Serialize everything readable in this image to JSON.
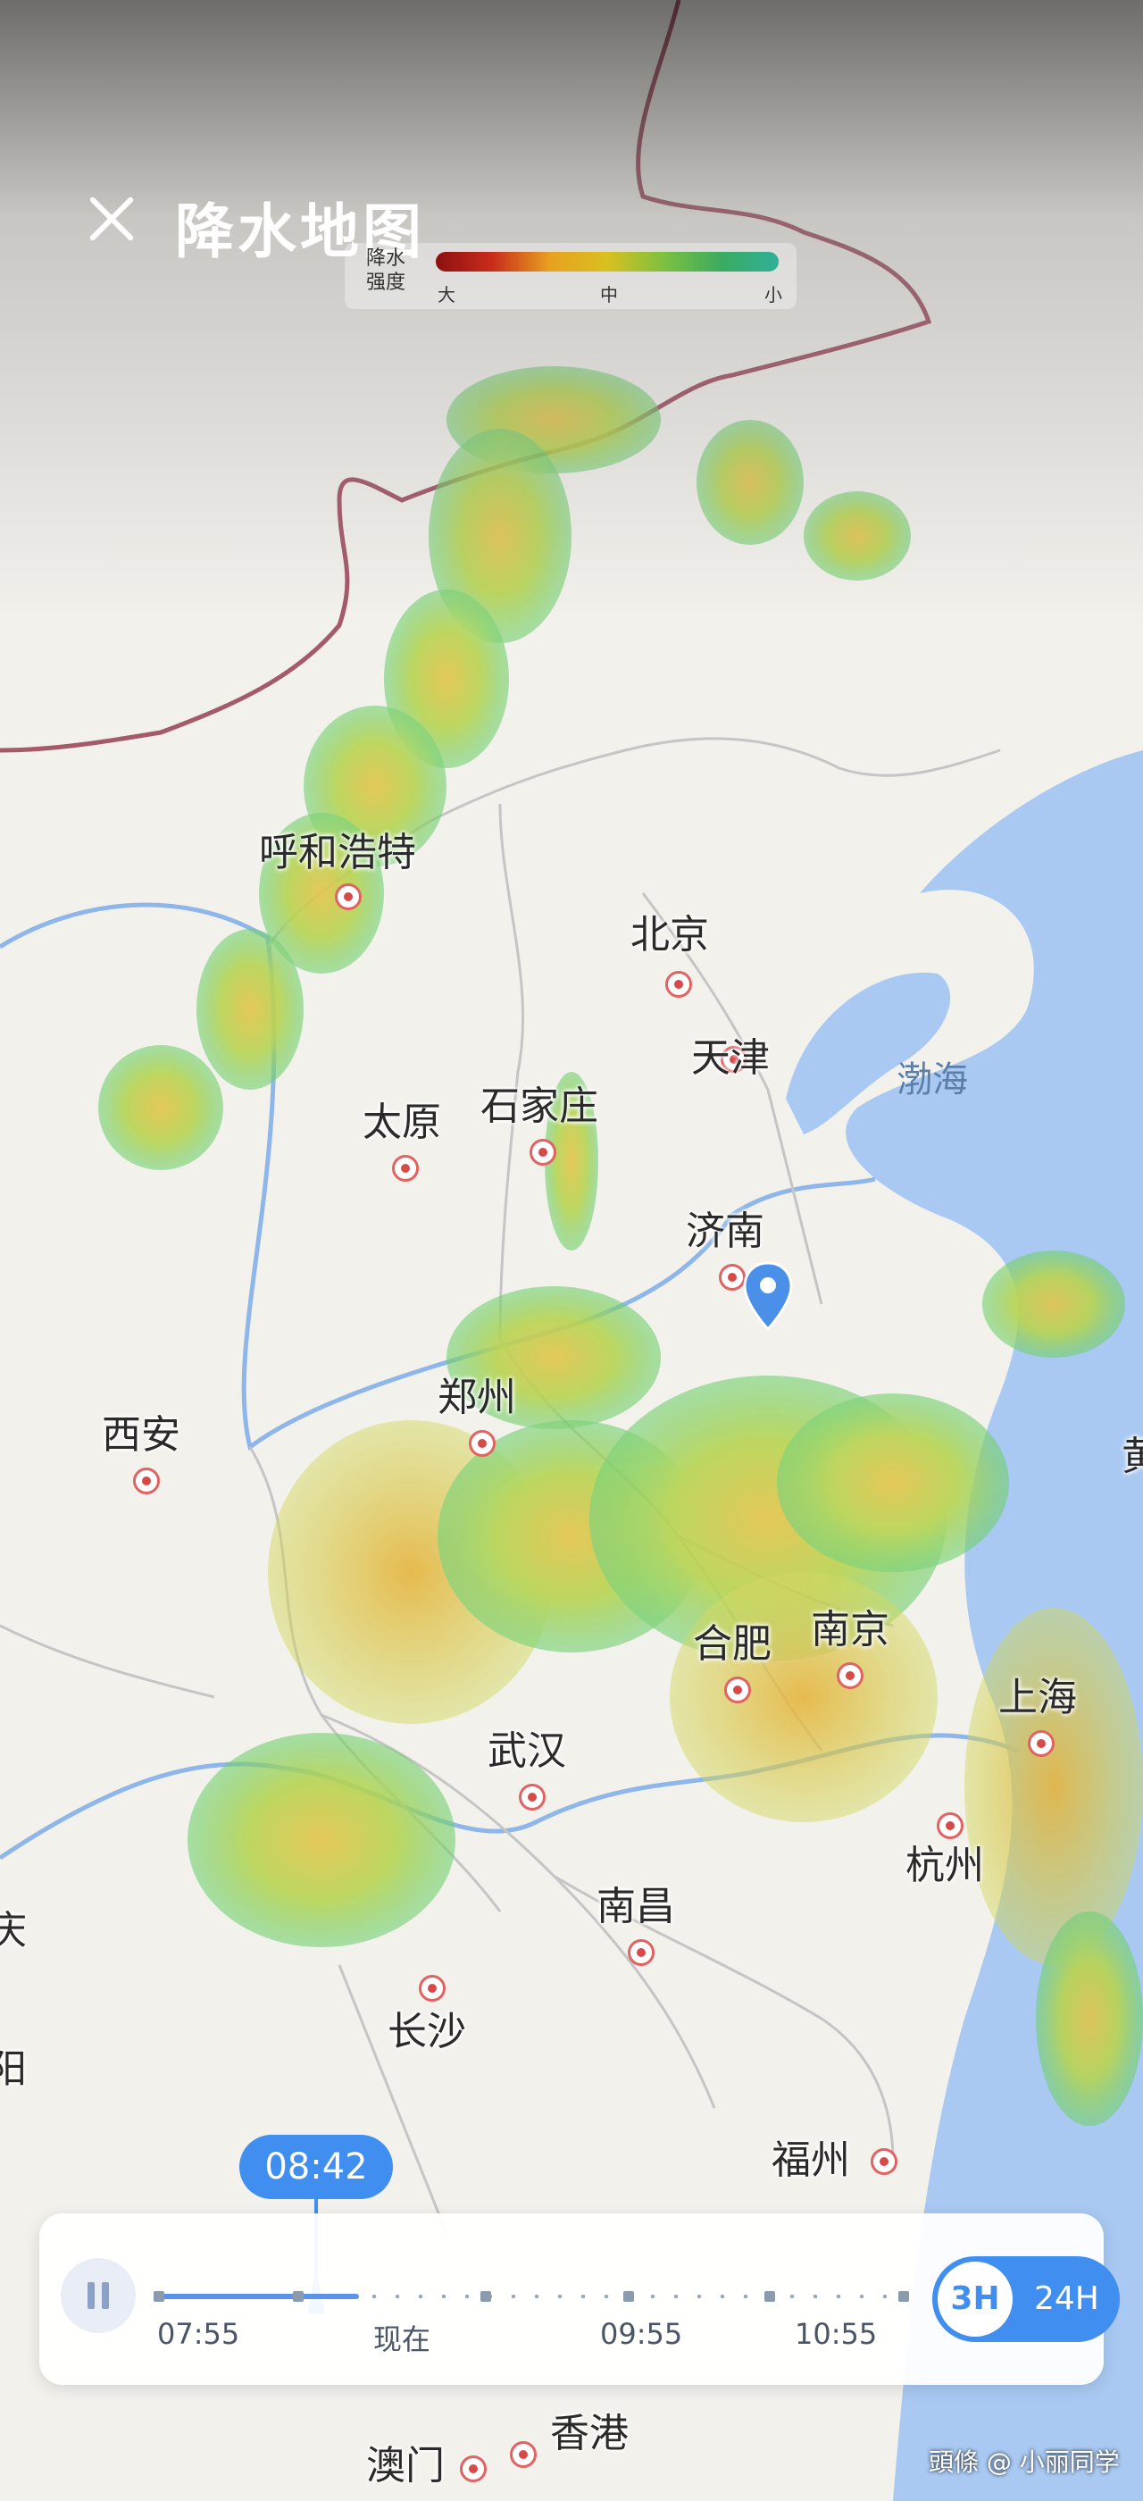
{
  "header": {
    "title": "降水地图",
    "close_icon": "close-icon"
  },
  "legend": {
    "label": "降水 强度",
    "low_label": "小",
    "mid_label": "中",
    "high_label": "大",
    "colors": [
      "#8e1010",
      "#c92d1b",
      "#e8a020",
      "#d9c020",
      "#7cc040",
      "#3aab60",
      "#30b09a"
    ]
  },
  "map": {
    "cities": [
      "呼和浩特",
      "北京",
      "天津",
      "石家庄",
      "太原",
      "济南",
      "西安",
      "郑州",
      "合肥",
      "南京",
      "上海",
      "武汉",
      "杭州",
      "南昌",
      "长沙",
      "福州",
      "澳门",
      "香港"
    ],
    "seas": [
      "渤海"
    ],
    "partial_labels": [
      "庆",
      "阳",
      "黄"
    ],
    "location_marker": "location-pin-icon"
  },
  "timeline": {
    "current_time": "08:42",
    "labels": [
      "07:55",
      "现在",
      "09:55",
      "10:55"
    ],
    "range_options": [
      "3H",
      "24H"
    ],
    "selected_range": "3H",
    "state": "pause-icon"
  },
  "watermark": "頭條 @ 小丽同学"
}
